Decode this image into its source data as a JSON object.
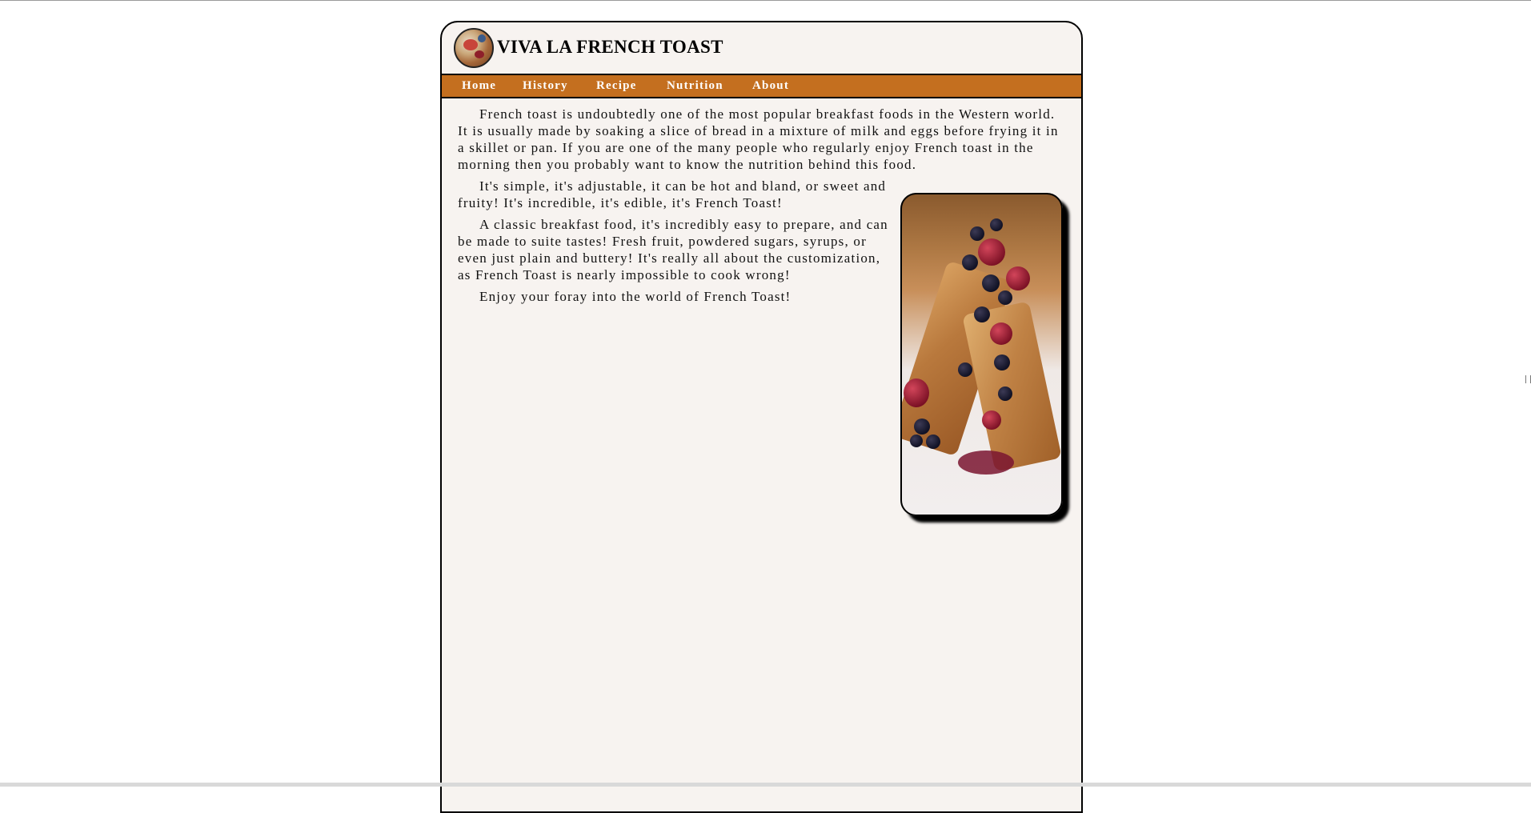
{
  "site": {
    "title": "VIVA LA FRENCH TOAST"
  },
  "nav": {
    "items": [
      {
        "label": "Home"
      },
      {
        "label": "History"
      },
      {
        "label": "Recipe"
      },
      {
        "label": "Nutrition"
      },
      {
        "label": "About"
      }
    ]
  },
  "content": {
    "paragraphs": [
      "French toast is undoubtedly one of the most popular breakfast foods in the Western world. It is usually made by soaking a slice of bread in a mixture of milk and eggs before frying it in a skillet or pan. If you are one of the many people who regularly enjoy French toast in the morning then you probably want to know the nutrition behind this food.",
      "It's simple, it's adjustable, it can be hot and bland, or sweet and fruity! It's incredible, it's edible, it's French Toast!",
      "A classic breakfast food, it's incredibly easy to prepare, and can be made to suite tastes! Fresh fruit, powdered sugars, syrups, or even just plain and buttery! It's really all about the customization, as French Toast is nearly impossible to cook wrong!",
      "Enjoy your foray into the world of French Toast!"
    ]
  },
  "colors": {
    "nav_bg": "#c46f1f",
    "page_bg": "#f7f3f0"
  }
}
